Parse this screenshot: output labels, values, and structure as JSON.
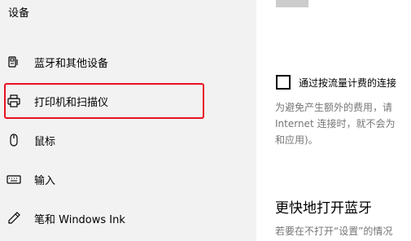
{
  "sidebar": {
    "title": "设备",
    "items": [
      {
        "label": "蓝牙和其他设备",
        "icon": "bluetooth-devices-icon"
      },
      {
        "label": "打印机和扫描仪",
        "icon": "printer-icon"
      },
      {
        "label": "鼠标",
        "icon": "mouse-icon"
      },
      {
        "label": "输入",
        "icon": "keyboard-icon"
      },
      {
        "label": "笔和 Windows Ink",
        "icon": "pen-icon"
      }
    ],
    "highlight_color": "#e81123"
  },
  "main": {
    "metered_checkbox": {
      "label": "通过按流量计费的连接",
      "checked": false
    },
    "metered_description": [
      "为避免产生额外的费用，请",
      "Internet 连接时，就不会为",
      "和应用)。"
    ],
    "section": {
      "title": "更快地打开蓝牙",
      "description": "若要在不打开“设置”的情况"
    }
  }
}
